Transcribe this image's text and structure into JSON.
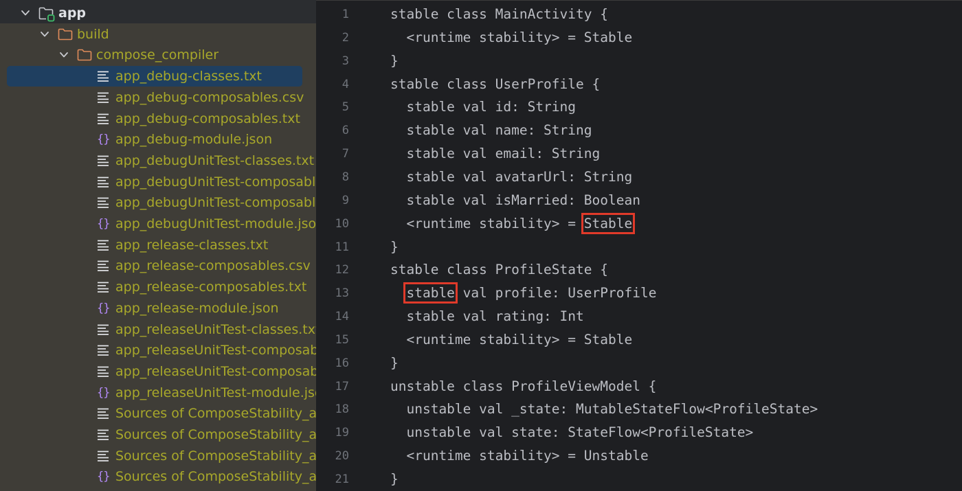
{
  "project_tree": {
    "root": {
      "label": "app"
    },
    "folders": [
      {
        "label": "build"
      },
      {
        "label": "compose_compiler"
      }
    ],
    "files": [
      {
        "label": "app_debug-classes.txt",
        "icon": "text-file-icon",
        "selected": true
      },
      {
        "label": "app_debug-composables.csv",
        "icon": "text-file-icon"
      },
      {
        "label": "app_debug-composables.txt",
        "icon": "text-file-icon"
      },
      {
        "label": "app_debug-module.json",
        "icon": "json-file-icon"
      },
      {
        "label": "app_debugUnitTest-classes.txt",
        "icon": "text-file-icon"
      },
      {
        "label": "app_debugUnitTest-composables.csv",
        "icon": "text-file-icon"
      },
      {
        "label": "app_debugUnitTest-composables.txt",
        "icon": "text-file-icon"
      },
      {
        "label": "app_debugUnitTest-module.json",
        "icon": "json-file-icon"
      },
      {
        "label": "app_release-classes.txt",
        "icon": "text-file-icon"
      },
      {
        "label": "app_release-composables.csv",
        "icon": "text-file-icon"
      },
      {
        "label": "app_release-composables.txt",
        "icon": "text-file-icon"
      },
      {
        "label": "app_release-module.json",
        "icon": "json-file-icon"
      },
      {
        "label": "app_releaseUnitTest-classes.txt",
        "icon": "text-file-icon"
      },
      {
        "label": "app_releaseUnitTest-composables.csv",
        "icon": "text-file-icon"
      },
      {
        "label": "app_releaseUnitTest-composables.txt",
        "icon": "text-file-icon"
      },
      {
        "label": "app_releaseUnitTest-module.json",
        "icon": "json-file-icon"
      },
      {
        "label": "Sources of ComposeStability_app",
        "icon": "text-file-icon"
      },
      {
        "label": "Sources of ComposeStability_app",
        "icon": "text-file-icon"
      },
      {
        "label": "Sources of ComposeStability_app",
        "icon": "text-file-icon"
      },
      {
        "label": "Sources of ComposeStability_app",
        "icon": "json-file-icon"
      }
    ]
  },
  "editor": {
    "lines": [
      {
        "n": "1",
        "text": "stable class MainActivity {"
      },
      {
        "n": "2",
        "text": "  <runtime stability> = Stable"
      },
      {
        "n": "3",
        "text": "}"
      },
      {
        "n": "4",
        "text": "stable class UserProfile {"
      },
      {
        "n": "5",
        "text": "  stable val id: String"
      },
      {
        "n": "6",
        "text": "  stable val name: String"
      },
      {
        "n": "7",
        "text": "  stable val email: String"
      },
      {
        "n": "8",
        "text": "  stable val avatarUrl: String"
      },
      {
        "n": "9",
        "text": "  stable val isMarried: Boolean"
      },
      {
        "n": "10",
        "text": "  <runtime stability> = ",
        "highlight": "Stable",
        "after": ""
      },
      {
        "n": "11",
        "text": "}"
      },
      {
        "n": "12",
        "text": "stable class ProfileState {"
      },
      {
        "n": "13",
        "text": "  ",
        "highlight": "stable",
        "after": " val profile: UserProfile"
      },
      {
        "n": "14",
        "text": "  stable val rating: Int"
      },
      {
        "n": "15",
        "text": "  <runtime stability> = Stable"
      },
      {
        "n": "16",
        "text": "}"
      },
      {
        "n": "17",
        "text": "unstable class ProfileViewModel {"
      },
      {
        "n": "18",
        "text": "  unstable val _state: MutableStateFlow<ProfileState>"
      },
      {
        "n": "19",
        "text": "  unstable val state: StateFlow<ProfileState>"
      },
      {
        "n": "20",
        "text": "  <runtime stability> = Unstable"
      },
      {
        "n": "21",
        "text": "}"
      }
    ],
    "highlight_color": "#e03a2a"
  },
  "colors": {
    "tree_background": "#3f3d37",
    "tree_text": "#a8a82a",
    "selection": "#1f3f60",
    "folder_icon": "#e08c5a",
    "json_icon": "#b189f5",
    "editor_background": "#1e1f22",
    "code_text": "#bcbec4",
    "line_number": "#6f737a"
  }
}
